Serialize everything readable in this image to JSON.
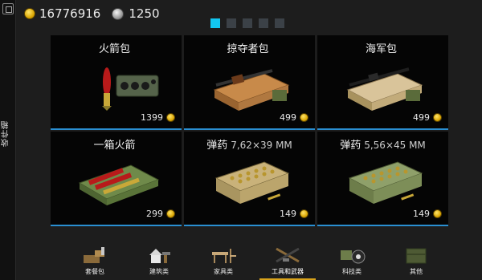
{
  "sidebar": {
    "label": "收件箱"
  },
  "currency": {
    "coins": "16776916",
    "gems": "1250"
  },
  "pager": {
    "pages": 5,
    "active": 0
  },
  "cards": [
    {
      "title": "火箭包",
      "subtitle": "",
      "price": "1399",
      "art": "rocket-pack"
    },
    {
      "title": "掠夺者包",
      "subtitle": "",
      "price": "499",
      "art": "ak-crate"
    },
    {
      "title": "海军包",
      "subtitle": "",
      "price": "499",
      "art": "rifle-crate"
    },
    {
      "title": "一箱火箭",
      "subtitle": "",
      "price": "299",
      "art": "rocket-box"
    },
    {
      "title": "弹药",
      "subtitle": "7,62×39 MM",
      "price": "149",
      "art": "ammo-box-762"
    },
    {
      "title": "弹药",
      "subtitle": "5,56×45 MM",
      "price": "149",
      "art": "ammo-box-556"
    }
  ],
  "categories": [
    {
      "label": "套餐包",
      "icon": "bundle-icon"
    },
    {
      "label": "建筑类",
      "icon": "building-icon"
    },
    {
      "label": "家具类",
      "icon": "furniture-icon"
    },
    {
      "label": "工具和武器",
      "icon": "weapons-icon",
      "active": true
    },
    {
      "label": "科技类",
      "icon": "tech-icon"
    },
    {
      "label": "其他",
      "icon": "crate-icon"
    }
  ],
  "colors": {
    "accent": "#12c6f0",
    "card_underline": "#2a8fd2",
    "tab_underline": "#d9a41c",
    "coin": "#e6b412"
  }
}
